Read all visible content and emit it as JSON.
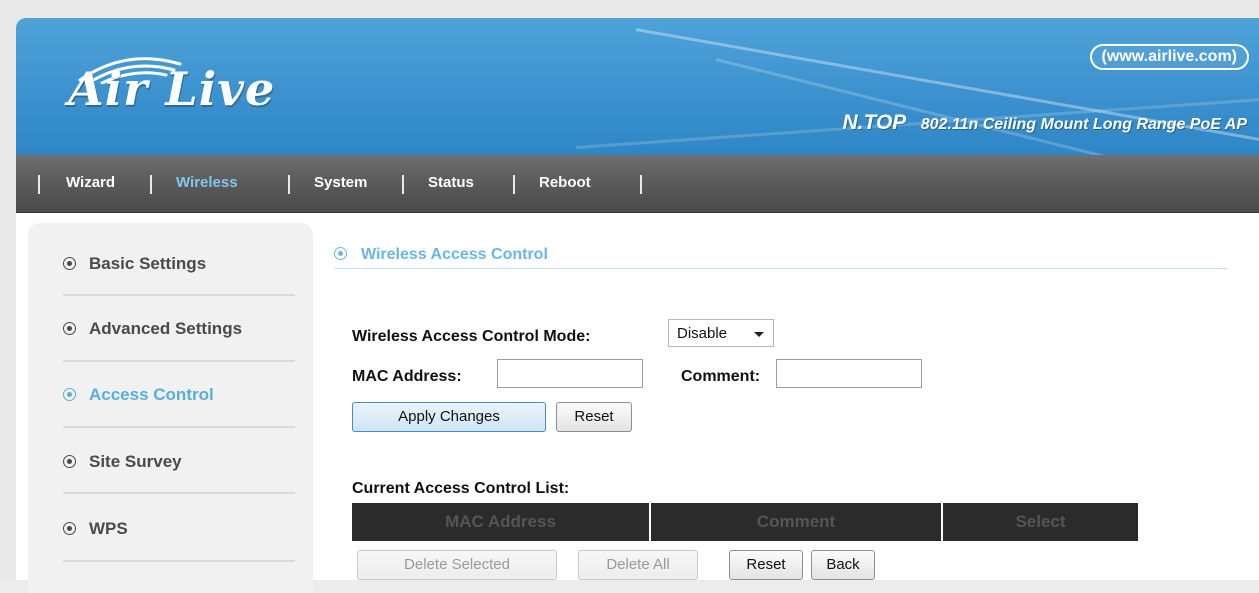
{
  "header": {
    "logo_text": "Air Live",
    "url_badge": "(www.airlive.com)",
    "brand": "N.TOP",
    "model": "802.11n Ceiling Mount Long Range PoE AP"
  },
  "nav": {
    "items": [
      {
        "label": "Wizard",
        "active": false
      },
      {
        "label": "Wireless",
        "active": true
      },
      {
        "label": "System",
        "active": false
      },
      {
        "label": "Status",
        "active": false
      },
      {
        "label": "Reboot",
        "active": false
      }
    ]
  },
  "sidebar": {
    "items": [
      {
        "label": "Basic Settings",
        "active": false
      },
      {
        "label": "Advanced Settings",
        "active": false
      },
      {
        "label": "Access Control",
        "active": true
      },
      {
        "label": "Site Survey",
        "active": false
      },
      {
        "label": "WPS",
        "active": false
      }
    ]
  },
  "main": {
    "section_title": "Wireless Access Control",
    "mode_label": "Wireless Access Control Mode:",
    "mode_value": "Disable",
    "mac_label": "MAC Address:",
    "mac_value": "",
    "comment_label": "Comment:",
    "comment_value": "",
    "apply_button": "Apply Changes",
    "reset_button": "Reset",
    "list_title": "Current Access Control List:",
    "table_headers": [
      "MAC Address",
      "Comment",
      "Select"
    ],
    "delete_selected_button": "Delete Selected",
    "delete_all_button": "Delete All",
    "list_reset_button": "Reset",
    "back_button": "Back"
  },
  "colors": {
    "banner": "#3c92cf",
    "nav_bg": "#5a5a5a",
    "active_accent": "#58aee0",
    "table_header_bg": "#2b2b2b"
  }
}
